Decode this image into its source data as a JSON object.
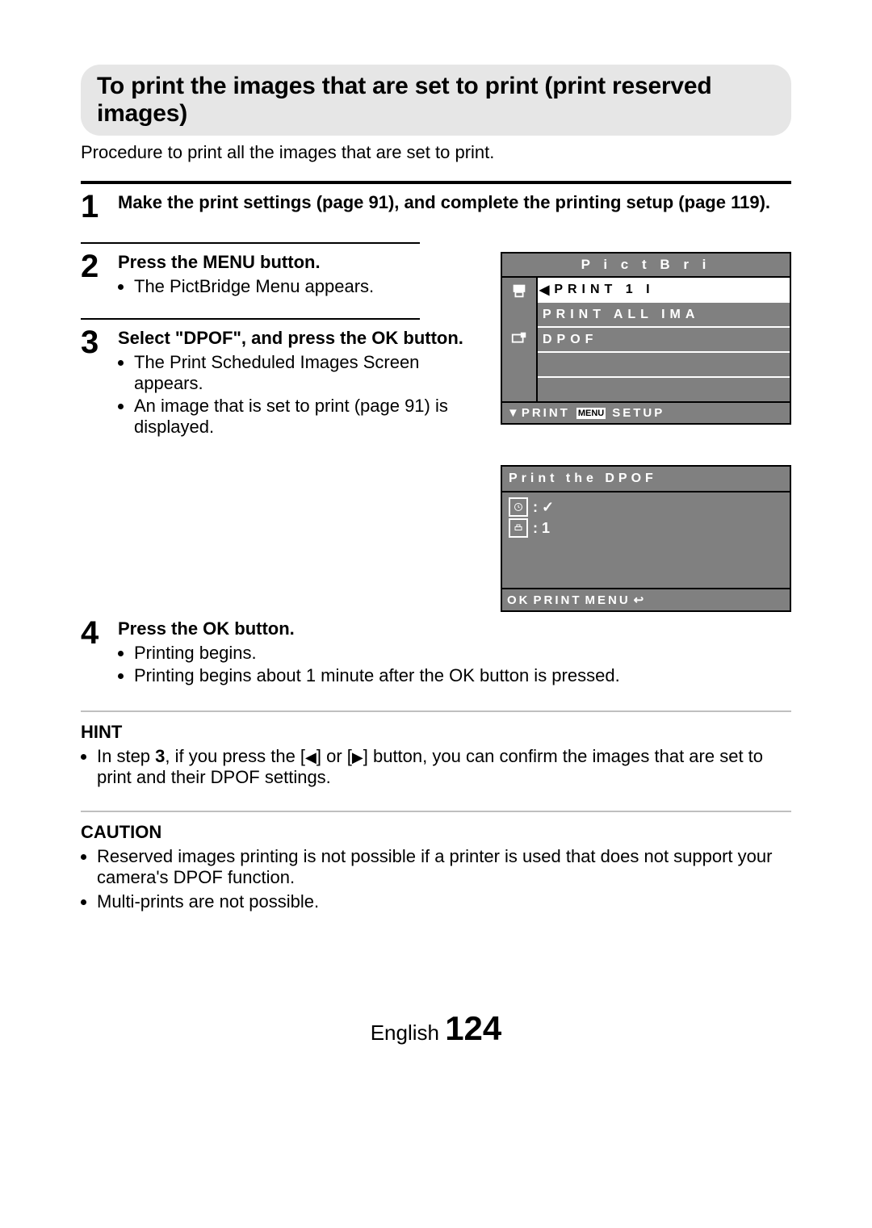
{
  "title": "To print the images that are set to print (print reserved images)",
  "intro": "Procedure to print all the images that are set to print.",
  "steps": {
    "s1": {
      "num": "1",
      "head": "Make the print settings (page 91), and complete the printing setup (page 119)."
    },
    "s2": {
      "num": "2",
      "head": "Press the MENU button.",
      "bullets": [
        "The PictBridge Menu appears."
      ]
    },
    "s3": {
      "num": "3",
      "head": "Select \"DPOF\", and press the OK button.",
      "bullets": [
        "The Print Scheduled Images Screen appears.",
        "An image that is set to print (page 91) is displayed."
      ]
    },
    "s4": {
      "num": "4",
      "head": "Press the OK button.",
      "bullets": [
        "Printing begins.",
        "Printing begins about 1 minute after the OK button is pressed."
      ]
    }
  },
  "lcd1": {
    "title": "P i c t B r i",
    "rows": {
      "r1": "PRINT 1 I",
      "r2": "PRINT ALL IMA",
      "r3": "DPOF"
    },
    "bottom_left": "▼PRINT",
    "bottom_tag": "MENU",
    "bottom_right": "SETUP"
  },
  "lcd2": {
    "title": "Print the DPOF",
    "line1_val": "✓",
    "line2_val": "1",
    "bottom_ok": "OK",
    "bottom_print": "PRINT",
    "bottom_menu": "MENU",
    "bottom_back": "↩"
  },
  "hint": {
    "head": "HINT",
    "text_pre": "In step ",
    "text_bold": "3",
    "text_mid": ", if you press the [",
    "arrow_l": "◀",
    "text_or": "] or [",
    "arrow_r": "▶",
    "text_post": "] button, you can confirm the images that are set to print and their DPOF settings."
  },
  "caution": {
    "head": "CAUTION",
    "items": [
      "Reserved images printing is not possible if a printer is used that does not support your camera's DPOF function.",
      "Multi-prints are not possible."
    ]
  },
  "footer": {
    "lang": "English ",
    "page": "124"
  }
}
